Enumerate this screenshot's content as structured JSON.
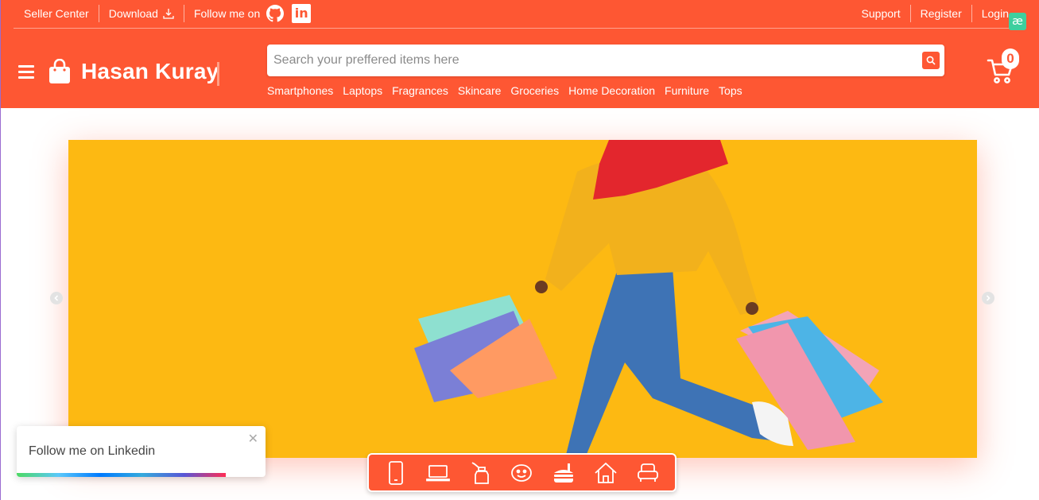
{
  "topbar": {
    "seller_center": "Seller Center",
    "download": "Download",
    "follow": "Follow me on",
    "linkedin_glyph": "in",
    "support": "Support",
    "register": "Register",
    "login": "Login",
    "extension_badge": "æ"
  },
  "brand": {
    "name": "Hasan Kuray"
  },
  "search": {
    "placeholder": "Search your preffered items here",
    "value": ""
  },
  "categories": [
    "Smartphones",
    "Laptops",
    "Fragrances",
    "Skincare",
    "Groceries",
    "Home Decoration",
    "Furniture",
    "Tops"
  ],
  "cart": {
    "count": "0"
  },
  "category_icons": [
    "smartphone-icon",
    "laptop-icon",
    "fragrance-icon",
    "skincare-icon",
    "groceries-icon",
    "home-decoration-icon",
    "furniture-icon"
  ],
  "toast": {
    "message": "Follow me on Linkedin",
    "close": "✕",
    "progress": 0.84
  },
  "colors": {
    "primary": "#fe5733",
    "banner_bg": "#fdb912",
    "white": "#ffffff"
  }
}
